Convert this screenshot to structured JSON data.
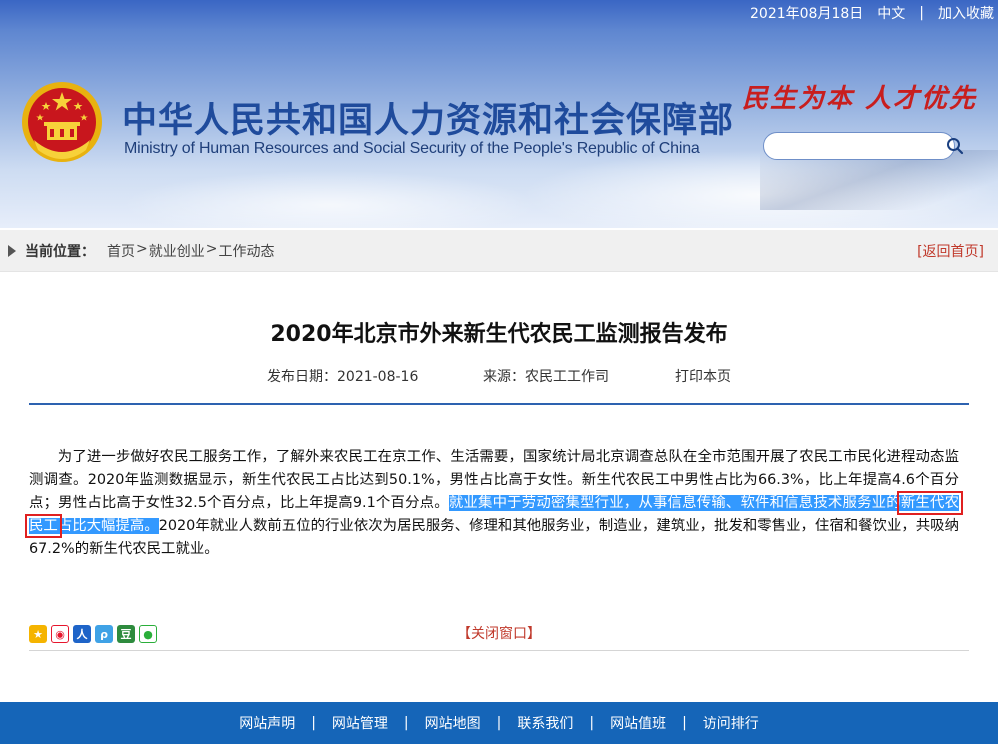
{
  "topbar": {
    "date": "2021年08月18日",
    "lang": "中文",
    "separator": "|",
    "bookmark": "加入收藏"
  },
  "header": {
    "ministry_cn": "中华人民共和国人力资源和社会保障部",
    "ministry_en": "Ministry of Human Resources and Social Security of the People's Republic of China",
    "slogan": "民生为本 人才优先",
    "search": {
      "placeholder": "",
      "value": ""
    },
    "colors": {
      "title": "#1f4b9c",
      "slogan": "#c81e1e",
      "emblem_red": "#c8161d",
      "emblem_gold": "#e8b20f"
    }
  },
  "breadcrumb": {
    "label": "当前位置：",
    "items": [
      "首页",
      "就业创业",
      "工作动态"
    ],
    "separator": ">",
    "back_home": "[返回首页]"
  },
  "article": {
    "title": "2020年北京市外来新生代农民工监测报告发布",
    "publish_date": "发布日期：2021-08-16",
    "source": "来源：农民工工作司",
    "print": "打印本页",
    "para_1": "为了进一步做好农民工服务工作，了解外来农民工在京工作、生活需要，国家统计局北京调查总队在全市范围开展了农民工市民化进程动态监测调查。2020年监测数据显示，新生代农民工占比达到50.1%，男性占比高于女性。新生代农民工中男性占比为66.3%，比上年提高4.6个百分点；男性占比高于女性32.5个百分点，比上年提高9.1个百分点。",
    "highlight_1": "就业集中于劳动密集型行业，从事信息传输、软件和信息技术服务业的",
    "highlight_boxed": "新生代农民工",
    "highlight_2": "占比大幅提高。",
    "para_2": "2020年就业人数前五位的行业依次为居民服务、修理和其他服务业，制造业，建筑业，批发和零售业，住宿和餐饮业，共吸纳67.2%的新生代农民工就业。",
    "close_window": "【关闭窗口】",
    "share_icons": [
      "qzone-icon",
      "weibo-icon",
      "renren-icon",
      "tencent-weibo-icon",
      "douban-icon",
      "wechat-icon"
    ]
  },
  "footer": {
    "links": [
      "网站声明",
      "网站管理",
      "网站地图",
      "联系我们",
      "网站值班",
      "访问排行"
    ],
    "separator": "|"
  }
}
